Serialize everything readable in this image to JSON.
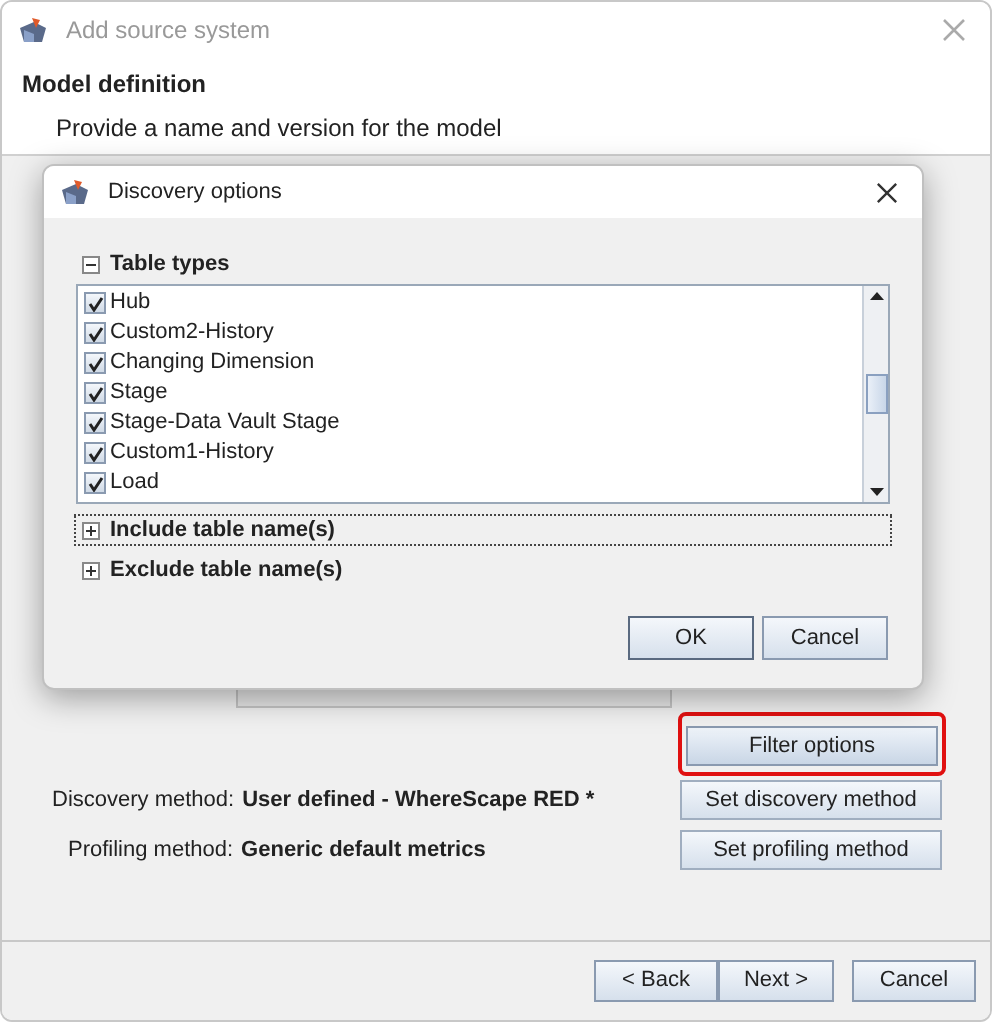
{
  "window": {
    "title": "Add source system"
  },
  "header": {
    "title": "Model definition",
    "subtitle": "Provide a name and version for the model"
  },
  "filter_button": {
    "label": "Filter options",
    "highlighted": true
  },
  "methods": [
    {
      "label": "Discovery method:",
      "value": "User defined - WhereScape RED *",
      "button": "Set discovery method"
    },
    {
      "label": "Profiling method:",
      "value": "Generic default metrics",
      "button": "Set profiling method"
    }
  ],
  "nav_buttons": [
    "< Back",
    "Next >",
    "Cancel"
  ],
  "dialog": {
    "title": "Discovery options",
    "sections": [
      {
        "title": "Table types",
        "expanded": true,
        "focused": false
      },
      {
        "title": "Include table name(s)",
        "expanded": false,
        "focused": true
      },
      {
        "title": "Exclude table name(s)",
        "expanded": false,
        "focused": false
      }
    ],
    "table_types": [
      {
        "label": "Hub",
        "checked": true
      },
      {
        "label": "Custom2-History",
        "checked": true
      },
      {
        "label": "Changing Dimension",
        "checked": true
      },
      {
        "label": "Stage",
        "checked": true
      },
      {
        "label": "Stage-Data Vault Stage",
        "checked": true
      },
      {
        "label": "Custom1-History",
        "checked": true
      },
      {
        "label": "Load",
        "checked": true
      }
    ],
    "buttons": [
      "OK",
      "Cancel"
    ]
  }
}
